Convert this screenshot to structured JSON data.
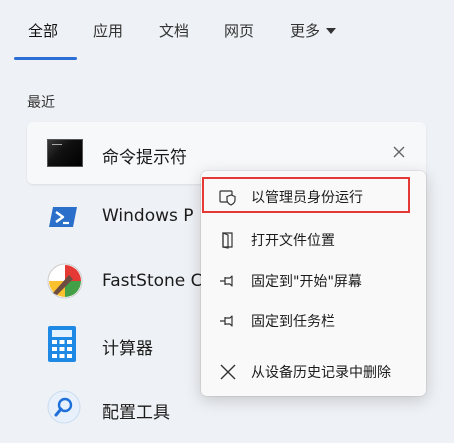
{
  "tabs": [
    {
      "label": "全部"
    },
    {
      "label": "应用"
    },
    {
      "label": "文档"
    },
    {
      "label": "网页"
    },
    {
      "label": "更多"
    }
  ],
  "section_title": "最近",
  "recent": {
    "label": "命令提示符"
  },
  "apps": [
    {
      "label": "Windows P",
      "icon": "powershell-icon"
    },
    {
      "label": "FastStone C",
      "icon": "faststone-capture-icon"
    },
    {
      "label": "计算器",
      "icon": "calculator-icon"
    },
    {
      "label": "配置工具",
      "icon": "config-tool-icon"
    }
  ],
  "context_menu": {
    "items": [
      {
        "label": "以管理员身份运行",
        "icon": "shield-icon"
      },
      {
        "label": "打开文件位置",
        "icon": "folder-open-icon"
      },
      {
        "label": "固定到\"开始\"屏幕",
        "icon": "pin-icon"
      },
      {
        "label": "固定到任务栏",
        "icon": "pin-icon"
      },
      {
        "label": "从设备历史记录中删除",
        "icon": "close-icon"
      }
    ]
  },
  "colors": {
    "accent": "#2b6fd6",
    "highlight": "#e53935"
  }
}
